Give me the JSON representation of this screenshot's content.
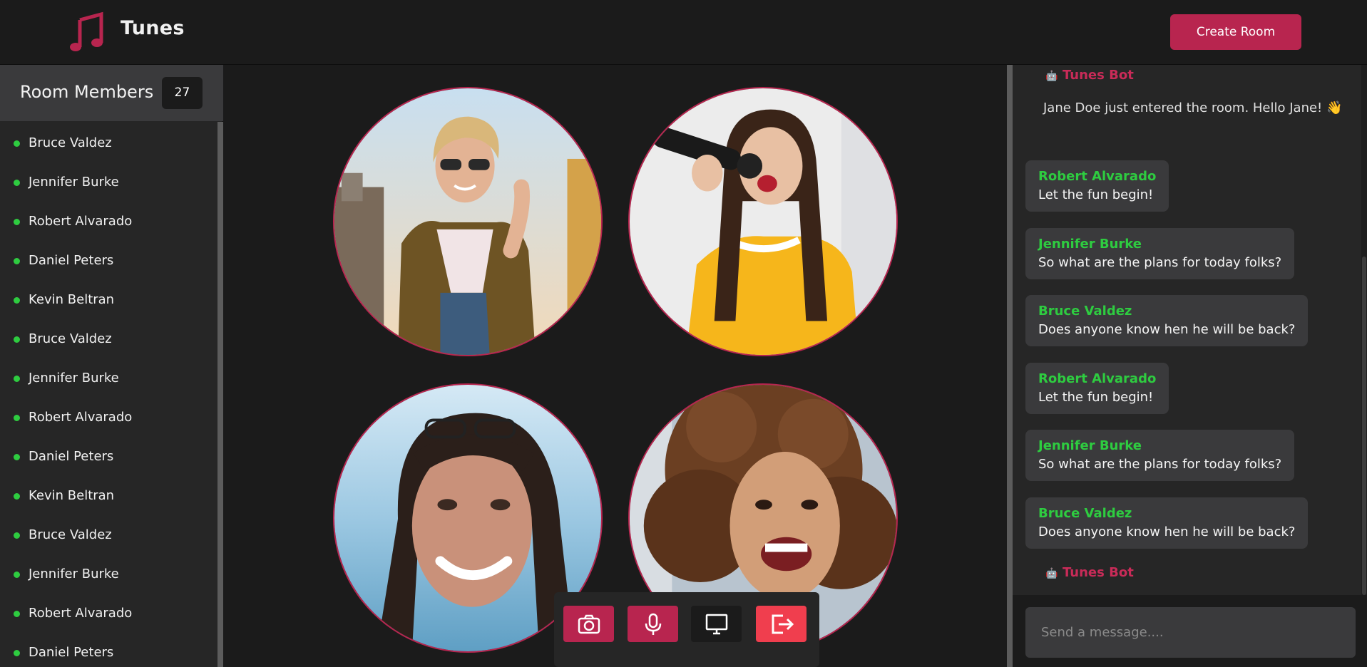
{
  "app": {
    "name": "Tunes"
  },
  "header": {
    "create_room_label": "Create Room"
  },
  "sidebar": {
    "title": "Room Members",
    "count": "27",
    "members": [
      "Bruce Valdez",
      "Jennifer Burke",
      "Robert Alvarado",
      "Daniel Peters",
      "Kevin Beltran",
      "Bruce Valdez",
      "Jennifer Burke",
      "Robert Alvarado",
      "Daniel Peters",
      "Kevin Beltran",
      "Bruce Valdez",
      "Jennifer Burke",
      "Robert Alvarado",
      "Daniel Peters"
    ],
    "online_color": "#2ecc40"
  },
  "stage": {
    "participants": [
      "woman-sunglasses-dancing",
      "woman-singing-microphone",
      "woman-smiling-sunglasses-on-head",
      "woman-curly-hair-laughing"
    ],
    "controls": [
      {
        "icon": "camera-icon",
        "color": "#b8254f"
      },
      {
        "icon": "microphone-icon",
        "color": "#b8254f"
      },
      {
        "icon": "monitor-icon",
        "color": "#262626"
      },
      {
        "icon": "exit-icon",
        "color": "#f03e4e"
      }
    ]
  },
  "chat": {
    "bot_name": "Tunes Bot",
    "bot_emoji": "🤖",
    "bot_message": "Jane Doe just entered the room. Hello Jane! 👋",
    "messages": [
      {
        "author": "Robert Alvarado",
        "text": "Let the fun begin!"
      },
      {
        "author": "Jennifer Burke",
        "text": "So what are the plans for today folks?"
      },
      {
        "author": "Bruce Valdez",
        "text": "Does anyone know hen he will be back?"
      },
      {
        "author": "Robert Alvarado",
        "text": "Let the fun begin!"
      },
      {
        "author": "Jennifer Burke",
        "text": "So what are the plans for today folks?"
      },
      {
        "author": "Bruce Valdez",
        "text": "Does anyone know hen he will be back?"
      }
    ],
    "input_placeholder": "Send a message...."
  },
  "colors": {
    "accent": "#b8254f",
    "bot_name": "#c92b58",
    "author": "#2ecc40",
    "danger": "#f03e4e"
  }
}
